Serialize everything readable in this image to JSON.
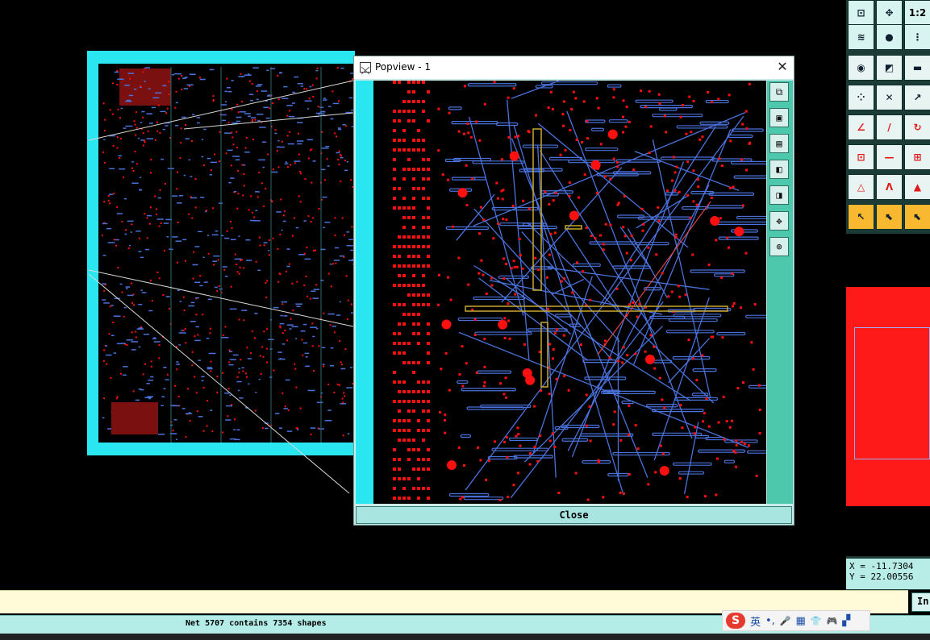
{
  "popview": {
    "title": "Popview - 1",
    "close_x": "✕",
    "close_button": "Close",
    "tools": [
      "⧉",
      "▣",
      "▤",
      "◧",
      "◨",
      "✥",
      "⊕"
    ]
  },
  "toolbar": {
    "zoom_ratio_label": "1:2",
    "rows": [
      [
        "fit-icon",
        "pan-icon",
        "zoom-ratio-icon"
      ],
      [
        "route-tool-icon",
        "component-icon",
        "net-highlight-icon"
      ],
      [
        "place-via-icon",
        "polygon-icon",
        "ruler-icon"
      ],
      [
        "pin-icon",
        "cross-icon",
        "move-pin-icon"
      ],
      [
        "angle-route-icon",
        "diagonal-route-icon",
        "arc-icon"
      ],
      [
        "add-node-icon",
        "line-icon",
        "bus-icon"
      ],
      [
        "triangle-icon",
        "vertex-icon",
        "shape-icon"
      ],
      [
        "select-arrow-icon",
        "select-box-icon",
        "select-snap-icon"
      ]
    ]
  },
  "coords": {
    "x": "X = -11.7304",
    "y": "Y = 22.00556"
  },
  "cmd": {
    "in_label": "In"
  },
  "status": {
    "text": "Net 5707 contains 7354 shapes"
  },
  "ime": {
    "logo": "S",
    "lang": "英",
    "punct": "•,",
    "mic": "🎤",
    "keyboard": "▦",
    "shirt": "👕",
    "game": "🎮",
    "grid": "▞"
  },
  "colors": {
    "board_outline": "#29e6f0",
    "trace_blue": "#4a72dc",
    "pad_red": "#ff1010",
    "trace_gold": "#c8a830",
    "panel_teal": "#4ec8ac"
  }
}
